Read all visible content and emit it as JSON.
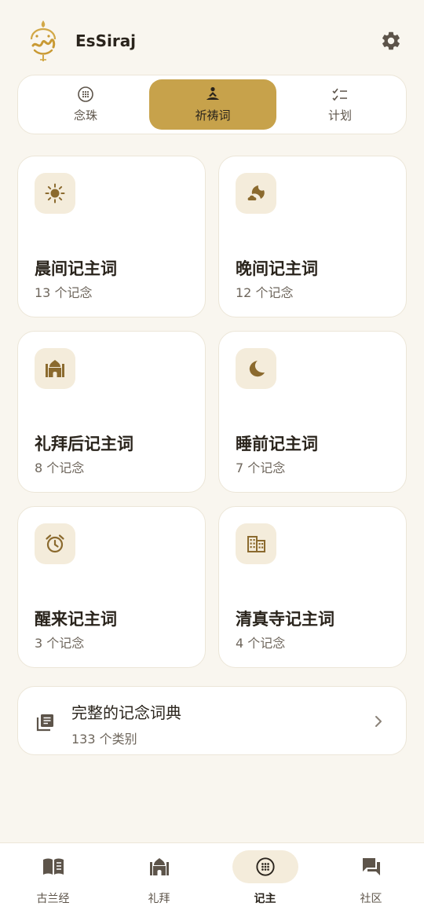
{
  "header": {
    "app_name": "EsSiraj",
    "logo_icon": "essiraj-calligraphy-logo",
    "settings_icon": "gear-icon"
  },
  "tabs": [
    {
      "label": "念珠",
      "icon": "tasbih-icon",
      "active": false
    },
    {
      "label": "祈祷词",
      "icon": "praying-person-icon",
      "active": true
    },
    {
      "label": "计划",
      "icon": "checklist-icon",
      "active": false
    }
  ],
  "categories": [
    {
      "title": "晨间记主词",
      "count": "13 个记念",
      "icon": "sun-icon"
    },
    {
      "title": "晚间记主词",
      "count": "12 个记念",
      "icon": "moon-cloud-icon"
    },
    {
      "title": "礼拜后记主词",
      "count": "8 个记念",
      "icon": "mosque-icon"
    },
    {
      "title": "睡前记主词",
      "count": "7 个记念",
      "icon": "crescent-moon-icon"
    },
    {
      "title": "醒来记主词",
      "count": "3 个记念",
      "icon": "alarm-clock-icon"
    },
    {
      "title": "清真寺记主词",
      "count": "4 个记念",
      "icon": "building-icon"
    }
  ],
  "dictionary": {
    "title": "完整的记念词典",
    "subtitle": "133 个类别",
    "icon": "library-books-icon"
  },
  "bottom_nav": [
    {
      "label": "古兰经",
      "icon": "book-icon",
      "active": false
    },
    {
      "label": "礼拜",
      "icon": "mosque-icon",
      "active": false
    },
    {
      "label": "记主",
      "icon": "tasbih-icon",
      "active": true
    },
    {
      "label": "社区",
      "icon": "chat-bubbles-icon",
      "active": false
    }
  ],
  "colors": {
    "background": "#f9f6ef",
    "accent_gold": "#c7a24b",
    "icon_brown": "#8b6a2e",
    "icon_bg": "#f4ecdb",
    "text_primary": "#2a241c",
    "text_secondary": "#6e665c"
  }
}
